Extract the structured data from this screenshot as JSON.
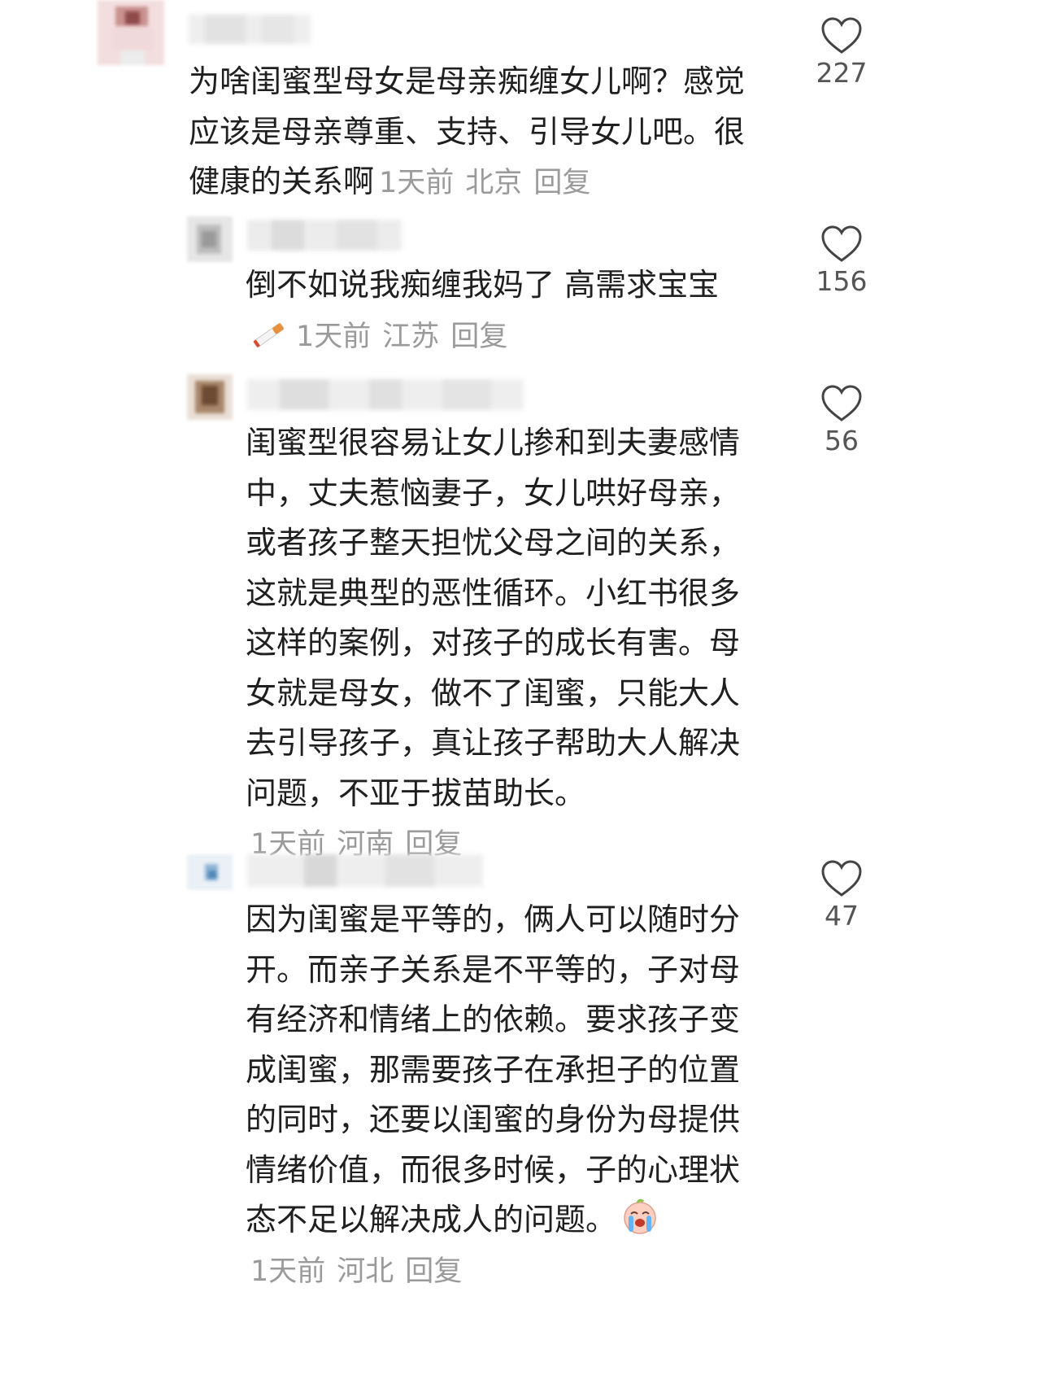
{
  "comments": [
    {
      "text": "为啥闺蜜型母女是母亲痴缠女儿啊？感觉应该是母亲尊重、支持、引导女儿吧。很健康的关系啊",
      "time": "1天前",
      "location": "北京",
      "reply_label": "回复",
      "like_count": "227",
      "like_icon": "heart-outline-icon"
    },
    {
      "text": "倒不如说我痴缠我妈了 高需求宝宝",
      "emoji_icon": "cigarette-emoji",
      "time": "1天前",
      "location": "江苏",
      "reply_label": "回复",
      "like_count": "156",
      "like_icon": "heart-outline-icon"
    },
    {
      "text": "闺蜜型很容易让女儿掺和到夫妻感情中，丈夫惹恼妻子，女儿哄好母亲，或者孩子整天担忧父母之间的关系，这就是典型的恶性循环。小红书很多这样的案例，对孩子的成长有害。母女就是母女，做不了闺蜜，只能大人去引导孩子，真让孩子帮助大人解决问题，不亚于拔苗助长。",
      "time": "1天前",
      "location": "河南",
      "reply_label": "回复",
      "like_count": "56",
      "like_icon": "heart-outline-icon"
    },
    {
      "text": "因为闺蜜是平等的，俩人可以随时分开。而亲子关系是不平等的，子对母有经济和情绪上的依赖。要求孩子变成闺蜜，那需要孩子在承担子的位置的同时，还要以闺蜜的身份为母提供情绪价值，而很多时候，子的心理状态不足以解决成人的问题。",
      "emoji_icon": "crying-emoji",
      "time": "1天前",
      "location": "河北",
      "reply_label": "回复",
      "like_count": "47",
      "like_icon": "heart-outline-icon"
    }
  ],
  "colors": {
    "text": "#1f1f1f",
    "meta": "#9a9a9a",
    "like_count": "#555555",
    "heart_stroke": "#444444"
  }
}
